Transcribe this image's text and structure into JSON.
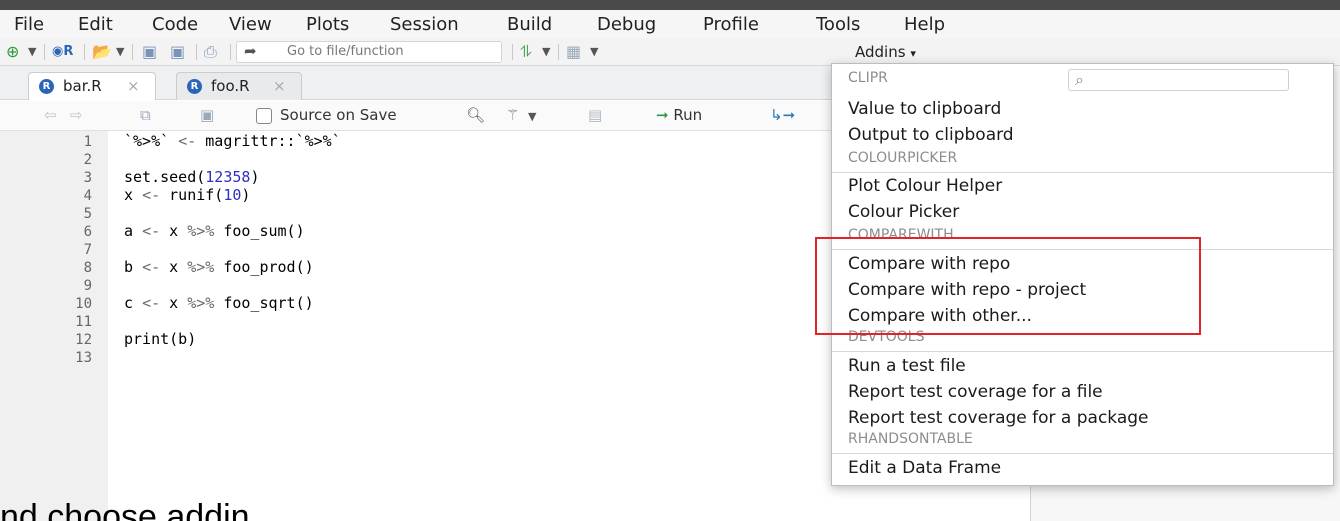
{
  "menubar": {
    "items": [
      "File",
      "Edit",
      "Code",
      "View",
      "Plots",
      "Session",
      "Build",
      "Debug",
      "Profile",
      "Tools",
      "Help"
    ]
  },
  "toolbar": {
    "goto_placeholder": "Go to file/function",
    "addins_label": "Addins",
    "addins_caret": "▾"
  },
  "tabs": [
    {
      "label": "bar.R",
      "active": true
    },
    {
      "label": "foo.R",
      "active": false
    }
  ],
  "editor_toolbar": {
    "source_on_save": "Source on Save",
    "run_label": "Run"
  },
  "code": {
    "line_numbers": [
      "1",
      "2",
      "3",
      "4",
      "5",
      "6",
      "7",
      "8",
      "9",
      "10",
      "11",
      "12",
      "13"
    ],
    "lines": [
      "`%>%` <- magrittr::`%>%`",
      "",
      "set.seed(12358)",
      "x <- runif(10)",
      "",
      "a <- x %>% foo_sum()",
      "",
      "b <- x %>% foo_prod()",
      "",
      "c <- x %>% foo_sqrt()",
      "",
      "print(b)",
      ""
    ]
  },
  "addins_menu": {
    "search_icon": "search-icon",
    "groups": [
      {
        "header": "CLIPR",
        "items": [
          "Value to clipboard",
          "Output to clipboard"
        ]
      },
      {
        "header": "COLOURPICKER",
        "items": [
          "Plot Colour Helper",
          "Colour Picker"
        ]
      },
      {
        "header": "COMPAREWITH",
        "items": [
          "Compare with repo",
          "Compare with repo - project",
          "Compare with other..."
        ]
      },
      {
        "header": "DEVTOOLS",
        "items": [
          "Run a test file",
          "Report test coverage for a file",
          "Report test coverage for a package"
        ]
      },
      {
        "header": "RHANDSONTABLE",
        "items": [
          "Edit a Data Frame"
        ]
      }
    ]
  },
  "annotation": {
    "highlight_color": "#e0242a"
  },
  "caption": "nd choose addin"
}
